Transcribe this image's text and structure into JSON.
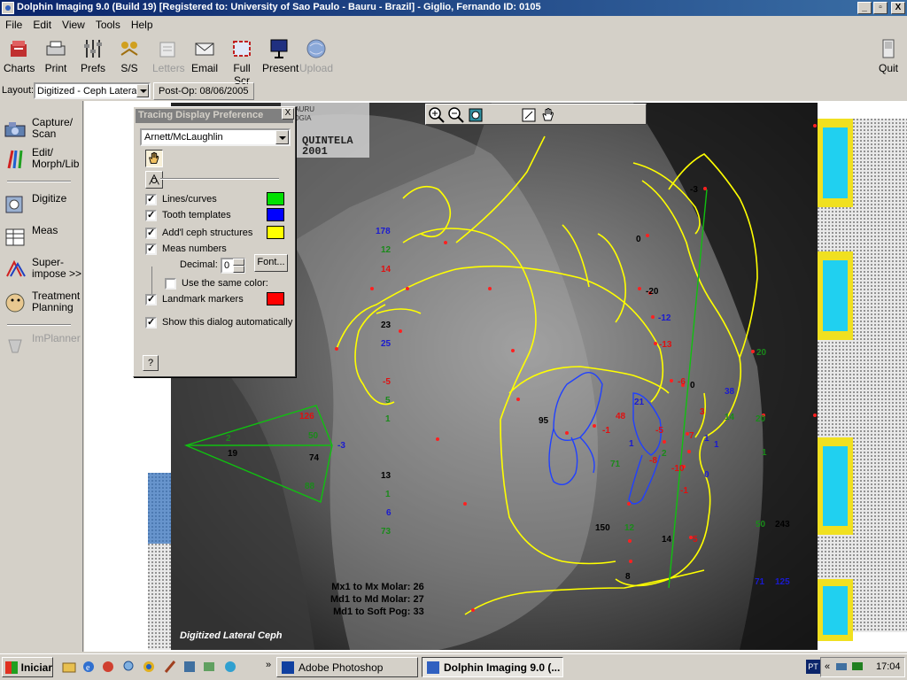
{
  "window": {
    "title": "Dolphin Imaging 9.0 (Build 19) [Registered to: University of Sao Paulo - Bauru - Brazil] - Giglio, Fernando  ID: 0105",
    "buttons": {
      "minimize": "_",
      "maximize": "▫",
      "close": "X"
    }
  },
  "menu": [
    "File",
    "Edit",
    "View",
    "Tools",
    "Help"
  ],
  "toolbar": {
    "charts": "Charts",
    "print": "Print",
    "prefs": "Prefs",
    "ss": "S/S",
    "letters": "Letters",
    "email": "Email",
    "fullscr": "Full Scr",
    "present": "Present",
    "upload": "Upload",
    "quit": "Quit"
  },
  "layout": {
    "label": "Layout:",
    "value": "Digitized - Ceph Lateral",
    "postop": "Post-Op: 08/06/2005"
  },
  "leftpanel": {
    "capture": "Capture/\nScan",
    "edit": "Edit/\nMorph/Lib",
    "digitize": "Digitize",
    "meas": "Meas",
    "superimpose": "Super-\nimpose >>",
    "treatment": "Treatment\nPlanning",
    "implanner": "ImPlanner"
  },
  "dialog": {
    "title": "Tracing Display Preference",
    "close": "X",
    "analysis": "Arnett/McLaughlin",
    "lines_curves": "Lines/curves",
    "tooth_templates": "Tooth templates",
    "addl_ceph": "Add'l ceph structures",
    "meas_numbers": "Meas numbers",
    "decimal_label": "Decimal:",
    "decimal_value": "0",
    "font_button": "Font...",
    "same_color": "Use the same color:",
    "landmark_markers": "Landmark markers",
    "show_auto": "Show this dialog automatically",
    "help": "?",
    "colors": {
      "lines": "#00e000",
      "tooth": "#0000ff",
      "ceph": "#ffff00",
      "landmark": "#ff0000"
    }
  },
  "canvas": {
    "film_text": [
      "BAURU",
      "LOGIA",
      "QUINTELA",
      "2001"
    ],
    "watermark": "Digitized Lateral Ceph",
    "stats": [
      "Mx1 to Mx Molar: 26",
      "Md1 to Md Molar: 27",
      "Md1 to Soft Pog: 33"
    ],
    "measurements": [
      {
        "text": "178",
        "color": "#1a1ad0"
      },
      {
        "text": "12",
        "color": "#1a8a1a"
      },
      {
        "text": "14",
        "color": "#e01010"
      },
      {
        "text": "23",
        "color": "#000"
      },
      {
        "text": "25",
        "color": "#1a1ad0"
      },
      {
        "text": "-5",
        "color": "#e01010"
      },
      {
        "text": "5",
        "color": "#1a8a1a"
      },
      {
        "text": "1",
        "color": "#1a8a1a"
      },
      {
        "text": "13",
        "color": "#000"
      },
      {
        "text": "1",
        "color": "#1a8a1a"
      },
      {
        "text": "6",
        "color": "#1a1ad0"
      },
      {
        "text": "73",
        "color": "#1a8a1a"
      },
      {
        "text": "126",
        "color": "#e01010"
      },
      {
        "text": "2",
        "color": "#1a8a1a"
      },
      {
        "text": "50",
        "color": "#1a8a1a"
      },
      {
        "text": "19",
        "color": "#000"
      },
      {
        "text": "74",
        "color": "#000"
      },
      {
        "text": "-3",
        "color": "#1a1ad0"
      },
      {
        "text": "88",
        "color": "#1a8a1a"
      },
      {
        "text": "95",
        "color": "#000"
      },
      {
        "text": "48",
        "color": "#e01010"
      },
      {
        "text": "-1",
        "color": "#e01010"
      },
      {
        "text": "21",
        "color": "#1a1ad0"
      },
      {
        "text": "-5",
        "color": "#e01010"
      },
      {
        "text": "1",
        "color": "#1a1ad0"
      },
      {
        "text": "71",
        "color": "#1a8a1a"
      },
      {
        "text": "-8",
        "color": "#e01010"
      },
      {
        "text": "2",
        "color": "#1a8a1a"
      },
      {
        "text": "150",
        "color": "#000"
      },
      {
        "text": "12",
        "color": "#1a8a1a"
      },
      {
        "text": "14",
        "color": "#000"
      },
      {
        "text": "8",
        "color": "#000"
      },
      {
        "text": "0",
        "color": "#000"
      },
      {
        "text": "-20",
        "color": "#000"
      },
      {
        "text": "-12",
        "color": "#1a1ad0"
      },
      {
        "text": "-13",
        "color": "#e01010"
      },
      {
        "text": "-6",
        "color": "#e01010"
      },
      {
        "text": "0",
        "color": "#000"
      },
      {
        "text": "38",
        "color": "#1a1ad0"
      },
      {
        "text": "3",
        "color": "#e01010"
      },
      {
        "text": "14",
        "color": "#1a8a1a"
      },
      {
        "text": "7",
        "color": "#e01010"
      },
      {
        "text": "1",
        "color": "#1a1ad0"
      },
      {
        "text": "1",
        "color": "#1a1ad0"
      },
      {
        "text": "-10",
        "color": "#e01010"
      },
      {
        "text": "0",
        "color": "#1a1ad0"
      },
      {
        "text": "-1",
        "color": "#e01010"
      },
      {
        "text": "5",
        "color": "#e01010"
      },
      {
        "text": "-3",
        "color": "#000"
      },
      {
        "text": "20",
        "color": "#1a8a1a"
      },
      {
        "text": "20",
        "color": "#1a8a1a"
      },
      {
        "text": "1",
        "color": "#1a8a1a"
      },
      {
        "text": "50",
        "color": "#1a8a1a"
      },
      {
        "text": "243",
        "color": "#000"
      },
      {
        "text": "71",
        "color": "#1a1ad0"
      },
      {
        "text": "125",
        "color": "#1a1ad0"
      }
    ]
  },
  "taskbar": {
    "start": "Iniciar",
    "tasks": [
      "Adobe Photoshop",
      "Dolphin Imaging 9.0 (..."
    ],
    "lang": "PT",
    "clock": "17:04"
  }
}
